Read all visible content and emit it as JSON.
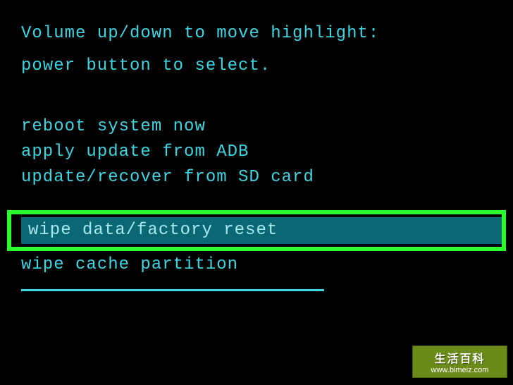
{
  "instructions": {
    "line1": "Volume up/down to move highlight:",
    "line2": "power button to select."
  },
  "menu": {
    "items": [
      "reboot system now",
      "apply update from ADB",
      "update/recover from SD card",
      "wipe data/factory reset",
      "wipe cache partition"
    ],
    "selected_index": 3
  },
  "watermark": {
    "title": "生活百科",
    "url": "www.bimeiz.com"
  }
}
